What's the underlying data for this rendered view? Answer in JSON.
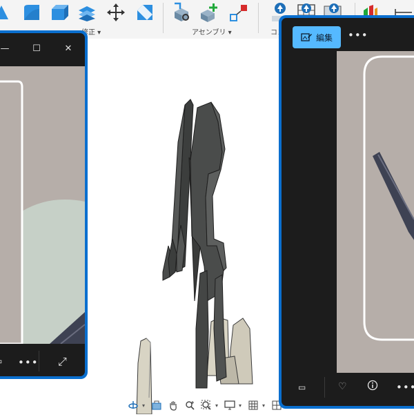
{
  "toolbar": {
    "group_modify_label": "修正 ▾",
    "group_assembly_label": "アセンブリ ▾",
    "group_construct_label": "コン"
  },
  "left_window": {
    "minimize": "—",
    "maximize": "☐",
    "close": "✕",
    "more": "•••",
    "expand": "⤢"
  },
  "right_window": {
    "edit_label": "編集",
    "more": "•••",
    "bottom_more": "•••"
  },
  "colors": {
    "accent_blue": "#0a6fcf",
    "edit_button": "#55b9ff",
    "photo_bg": "#b6aea9",
    "model_dark": "#4a4c4b",
    "model_light": "#d8d4c4"
  }
}
